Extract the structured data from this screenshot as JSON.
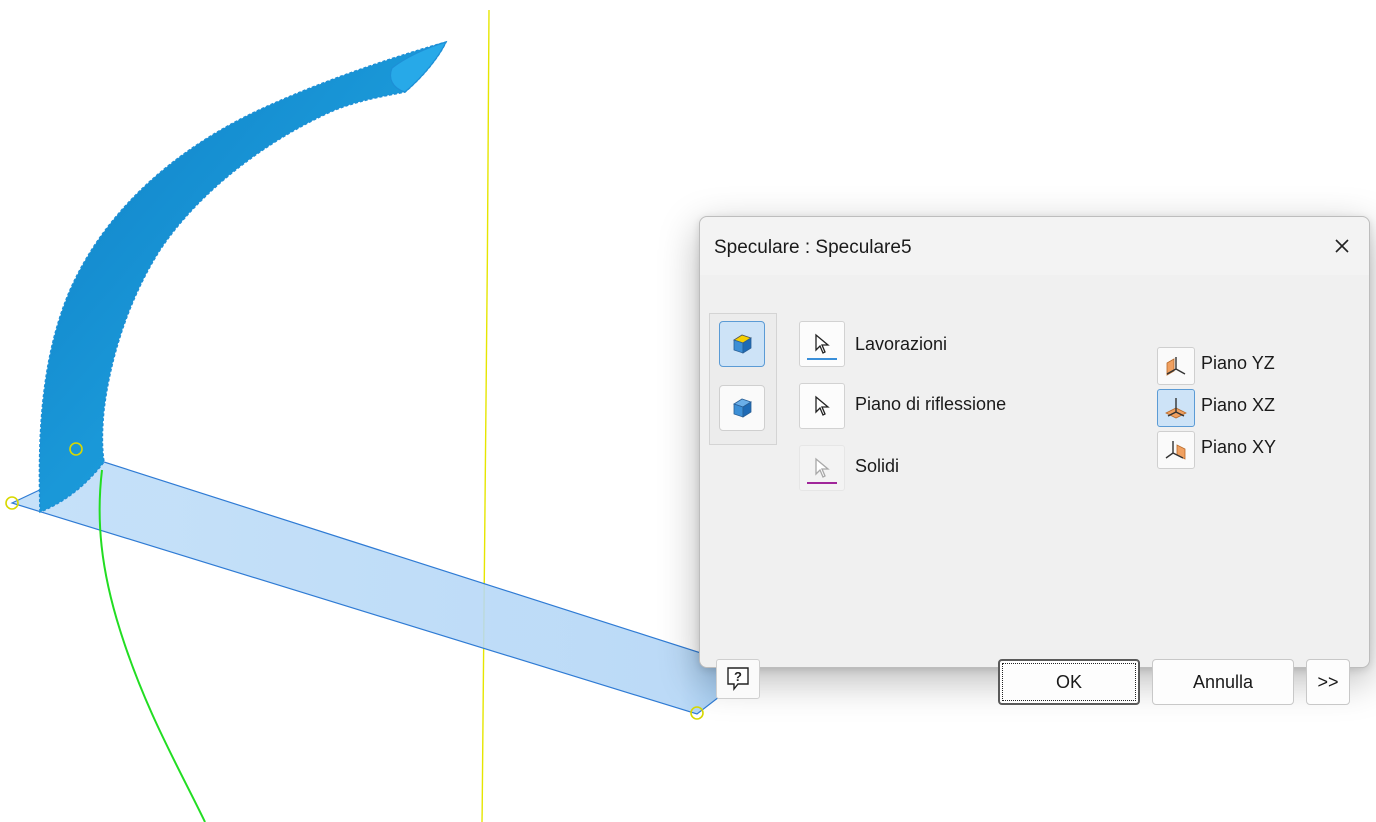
{
  "dialog": {
    "title": "Speculare : Speculare5",
    "close_icon": "close-icon",
    "modes": [
      {
        "icon": "mirror-features-icon",
        "active": true
      },
      {
        "icon": "mirror-solids-icon",
        "active": false
      }
    ],
    "selectors": [
      {
        "label": "Lavorazioni",
        "icon": "select-arrow-icon",
        "underline_color": "#3a8fd9"
      },
      {
        "label": "Piano di riflessione",
        "icon": "select-arrow-icon",
        "underline_color": ""
      },
      {
        "label": "Solidi",
        "icon": "select-arrow-icon",
        "underline_color": "#a0269a"
      }
    ],
    "planes": [
      {
        "label": "Piano YZ",
        "icon": "plane-yz-icon",
        "active": false
      },
      {
        "label": "Piano XZ",
        "icon": "plane-xz-icon",
        "active": true
      },
      {
        "label": "Piano XY",
        "icon": "plane-xy-icon",
        "active": false
      }
    ],
    "help_icon": "help-icon",
    "ok_label": "OK",
    "cancel_label": "Annulla",
    "more_label": ">>"
  },
  "colors": {
    "solid": "#1a98d8",
    "plane_fill": "#bcdcf8",
    "plane_edge": "#2f7bd4",
    "axis_yellow": "#e6e600",
    "curve_green": "#22dd22",
    "point_yellow": "#d8d800"
  }
}
